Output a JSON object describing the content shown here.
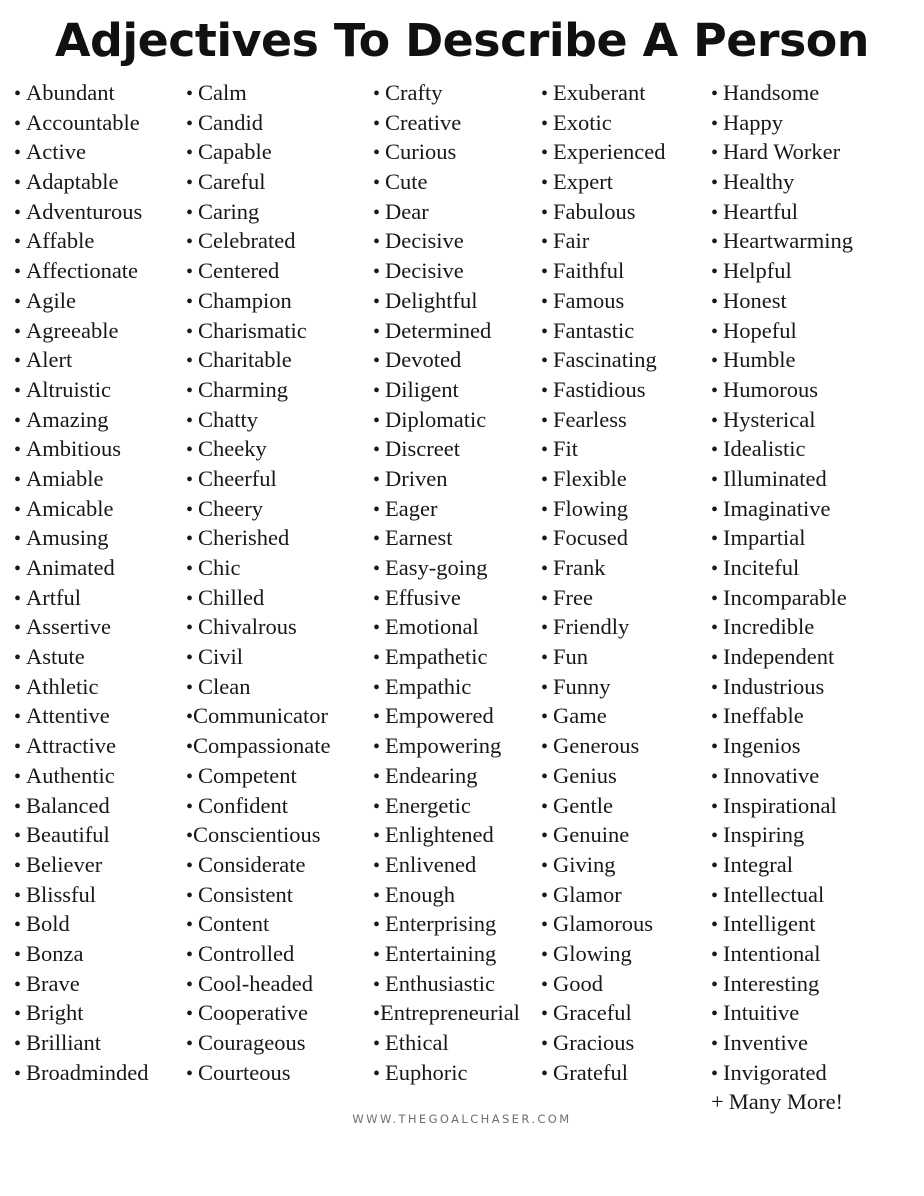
{
  "page": {
    "title": "Adjectives To Describe A Person",
    "background_color": "#ffffff",
    "text_color": "#181818",
    "title_color": "#111111",
    "footer_color": "#6f6f6f"
  },
  "footer": {
    "url": "WWW.THEGOALCHASER.COM"
  },
  "bullet_glyph": "•",
  "plus_glyph": "+",
  "columns": [
    {
      "name": "column-1",
      "items": [
        {
          "text": "Abundant",
          "tight": false
        },
        {
          "text": "Accountable",
          "tight": false
        },
        {
          "text": "Active",
          "tight": false
        },
        {
          "text": "Adaptable",
          "tight": false
        },
        {
          "text": "Adventurous",
          "tight": false
        },
        {
          "text": "Affable",
          "tight": false
        },
        {
          "text": "Affectionate",
          "tight": false
        },
        {
          "text": "Agile",
          "tight": false
        },
        {
          "text": "Agreeable",
          "tight": false
        },
        {
          "text": "Alert",
          "tight": false
        },
        {
          "text": "Altruistic",
          "tight": false
        },
        {
          "text": "Amazing",
          "tight": false
        },
        {
          "text": "Ambitious",
          "tight": false
        },
        {
          "text": "Amiable",
          "tight": false
        },
        {
          "text": "Amicable",
          "tight": false
        },
        {
          "text": "Amusing",
          "tight": false
        },
        {
          "text": "Animated",
          "tight": false
        },
        {
          "text": "Artful",
          "tight": false
        },
        {
          "text": "Assertive",
          "tight": false
        },
        {
          "text": "Astute",
          "tight": false
        },
        {
          "text": "Athletic",
          "tight": false
        },
        {
          "text": "Attentive",
          "tight": false
        },
        {
          "text": "Attractive",
          "tight": false
        },
        {
          "text": "Authentic",
          "tight": false
        },
        {
          "text": "Balanced",
          "tight": false
        },
        {
          "text": "Beautiful",
          "tight": false
        },
        {
          "text": "Believer",
          "tight": false
        },
        {
          "text": "Blissful",
          "tight": false
        },
        {
          "text": "Bold",
          "tight": false
        },
        {
          "text": "Bonza",
          "tight": false
        },
        {
          "text": "Brave",
          "tight": false
        },
        {
          "text": "Bright",
          "tight": false
        },
        {
          "text": "Brilliant",
          "tight": false
        },
        {
          "text": "Broadminded",
          "tight": false
        }
      ]
    },
    {
      "name": "column-2",
      "items": [
        {
          "text": "Calm",
          "tight": false
        },
        {
          "text": "Candid",
          "tight": false
        },
        {
          "text": "Capable",
          "tight": false
        },
        {
          "text": "Careful",
          "tight": false
        },
        {
          "text": "Caring",
          "tight": false
        },
        {
          "text": "Celebrated",
          "tight": false
        },
        {
          "text": "Centered",
          "tight": false
        },
        {
          "text": "Champion",
          "tight": false
        },
        {
          "text": "Charismatic",
          "tight": false
        },
        {
          "text": "Charitable",
          "tight": false
        },
        {
          "text": "Charming",
          "tight": false
        },
        {
          "text": "Chatty",
          "tight": false
        },
        {
          "text": "Cheeky",
          "tight": false
        },
        {
          "text": "Cheerful",
          "tight": false
        },
        {
          "text": "Cheery",
          "tight": false
        },
        {
          "text": "Cherished",
          "tight": false
        },
        {
          "text": "Chic",
          "tight": false
        },
        {
          "text": "Chilled",
          "tight": false
        },
        {
          "text": "Chivalrous",
          "tight": false
        },
        {
          "text": "Civil",
          "tight": false
        },
        {
          "text": "Clean",
          "tight": false
        },
        {
          "text": "Communicator",
          "tight": true
        },
        {
          "text": "Compassionate",
          "tight": true
        },
        {
          "text": "Competent",
          "tight": false
        },
        {
          "text": "Confident",
          "tight": false
        },
        {
          "text": "Conscientious",
          "tight": true
        },
        {
          "text": "Considerate",
          "tight": false
        },
        {
          "text": "Consistent",
          "tight": false
        },
        {
          "text": "Content",
          "tight": false
        },
        {
          "text": "Controlled",
          "tight": false
        },
        {
          "text": "Cool-headed",
          "tight": false
        },
        {
          "text": "Cooperative",
          "tight": false
        },
        {
          "text": "Courageous",
          "tight": false
        },
        {
          "text": "Courteous",
          "tight": false
        }
      ]
    },
    {
      "name": "column-3",
      "items": [
        {
          "text": "Crafty",
          "tight": false
        },
        {
          "text": "Creative",
          "tight": false
        },
        {
          "text": "Curious",
          "tight": false
        },
        {
          "text": "Cute",
          "tight": false
        },
        {
          "text": "Dear",
          "tight": false
        },
        {
          "text": "Decisive",
          "tight": false
        },
        {
          "text": "Decisive",
          "tight": false
        },
        {
          "text": "Delightful",
          "tight": false
        },
        {
          "text": "Determined",
          "tight": false
        },
        {
          "text": "Devoted",
          "tight": false
        },
        {
          "text": "Diligent",
          "tight": false
        },
        {
          "text": "Diplomatic",
          "tight": false
        },
        {
          "text": "Discreet",
          "tight": false
        },
        {
          "text": "Driven",
          "tight": false
        },
        {
          "text": "Eager",
          "tight": false
        },
        {
          "text": "Earnest",
          "tight": false
        },
        {
          "text": "Easy-going",
          "tight": false
        },
        {
          "text": "Effusive",
          "tight": false
        },
        {
          "text": "Emotional",
          "tight": false
        },
        {
          "text": "Empathetic",
          "tight": false
        },
        {
          "text": "Empathic",
          "tight": false
        },
        {
          "text": "Empowered",
          "tight": false
        },
        {
          "text": "Empowering",
          "tight": false
        },
        {
          "text": "Endearing",
          "tight": false
        },
        {
          "text": "Energetic",
          "tight": false
        },
        {
          "text": "Enlightened",
          "tight": false
        },
        {
          "text": "Enlivened",
          "tight": false
        },
        {
          "text": "Enough",
          "tight": false
        },
        {
          "text": "Enterprising",
          "tight": false
        },
        {
          "text": "Entertaining",
          "tight": false
        },
        {
          "text": "Enthusiastic",
          "tight": false
        },
        {
          "text": "Entrepreneurial",
          "tight": true
        },
        {
          "text": "Ethical",
          "tight": false
        },
        {
          "text": "Euphoric",
          "tight": false
        }
      ]
    },
    {
      "name": "column-4",
      "items": [
        {
          "text": "Exuberant",
          "tight": false
        },
        {
          "text": "Exotic",
          "tight": false
        },
        {
          "text": "Experienced",
          "tight": false
        },
        {
          "text": "Expert",
          "tight": false
        },
        {
          "text": "Fabulous",
          "tight": false
        },
        {
          "text": "Fair",
          "tight": false
        },
        {
          "text": "Faithful",
          "tight": false
        },
        {
          "text": "Famous",
          "tight": false
        },
        {
          "text": "Fantastic",
          "tight": false
        },
        {
          "text": "Fascinating",
          "tight": false
        },
        {
          "text": "Fastidious",
          "tight": false
        },
        {
          "text": "Fearless",
          "tight": false
        },
        {
          "text": "Fit",
          "tight": false
        },
        {
          "text": "Flexible",
          "tight": false
        },
        {
          "text": "Flowing",
          "tight": false
        },
        {
          "text": "Focused",
          "tight": false
        },
        {
          "text": "Frank",
          "tight": false
        },
        {
          "text": "Free",
          "tight": false
        },
        {
          "text": "Friendly",
          "tight": false
        },
        {
          "text": "Fun",
          "tight": false
        },
        {
          "text": "Funny",
          "tight": false
        },
        {
          "text": "Game",
          "tight": false
        },
        {
          "text": "Generous",
          "tight": false
        },
        {
          "text": "Genius",
          "tight": false
        },
        {
          "text": "Gentle",
          "tight": false
        },
        {
          "text": "Genuine",
          "tight": false
        },
        {
          "text": "Giving",
          "tight": false
        },
        {
          "text": "Glamor",
          "tight": false
        },
        {
          "text": "Glamorous",
          "tight": false
        },
        {
          "text": "Glowing",
          "tight": false
        },
        {
          "text": "Good",
          "tight": false
        },
        {
          "text": "Graceful",
          "tight": false
        },
        {
          "text": "Gracious",
          "tight": false
        },
        {
          "text": "Grateful",
          "tight": false
        }
      ]
    },
    {
      "name": "column-5",
      "items": [
        {
          "text": "Handsome",
          "tight": false
        },
        {
          "text": "Happy",
          "tight": false
        },
        {
          "text": "Hard Worker",
          "tight": false
        },
        {
          "text": "Healthy",
          "tight": false
        },
        {
          "text": "Heartful",
          "tight": false
        },
        {
          "text": "Heartwarming",
          "tight": false
        },
        {
          "text": "Helpful",
          "tight": false
        },
        {
          "text": "Honest",
          "tight": false
        },
        {
          "text": "Hopeful",
          "tight": false
        },
        {
          "text": "Humble",
          "tight": false
        },
        {
          "text": "Humorous",
          "tight": false
        },
        {
          "text": "Hysterical",
          "tight": false
        },
        {
          "text": "Idealistic",
          "tight": false
        },
        {
          "text": "Illuminated",
          "tight": false
        },
        {
          "text": "Imaginative",
          "tight": false
        },
        {
          "text": "Impartial",
          "tight": false
        },
        {
          "text": "Inciteful",
          "tight": false
        },
        {
          "text": "Incomparable",
          "tight": false
        },
        {
          "text": "Incredible",
          "tight": false
        },
        {
          "text": "Independent",
          "tight": false
        },
        {
          "text": "Industrious",
          "tight": false
        },
        {
          "text": "Ineffable",
          "tight": false
        },
        {
          "text": "Ingenios",
          "tight": false
        },
        {
          "text": "Innovative",
          "tight": false
        },
        {
          "text": "Inspirational",
          "tight": false
        },
        {
          "text": "Inspiring",
          "tight": false
        },
        {
          "text": "Integral",
          "tight": false
        },
        {
          "text": "Intellectual",
          "tight": false
        },
        {
          "text": "Intelligent",
          "tight": false
        },
        {
          "text": "Intentional",
          "tight": false
        },
        {
          "text": "Interesting",
          "tight": false
        },
        {
          "text": "Intuitive",
          "tight": false
        },
        {
          "text": "Inventive",
          "tight": false
        },
        {
          "text": "Invigorated",
          "tight": false
        }
      ],
      "trailing": "Many More!"
    }
  ]
}
